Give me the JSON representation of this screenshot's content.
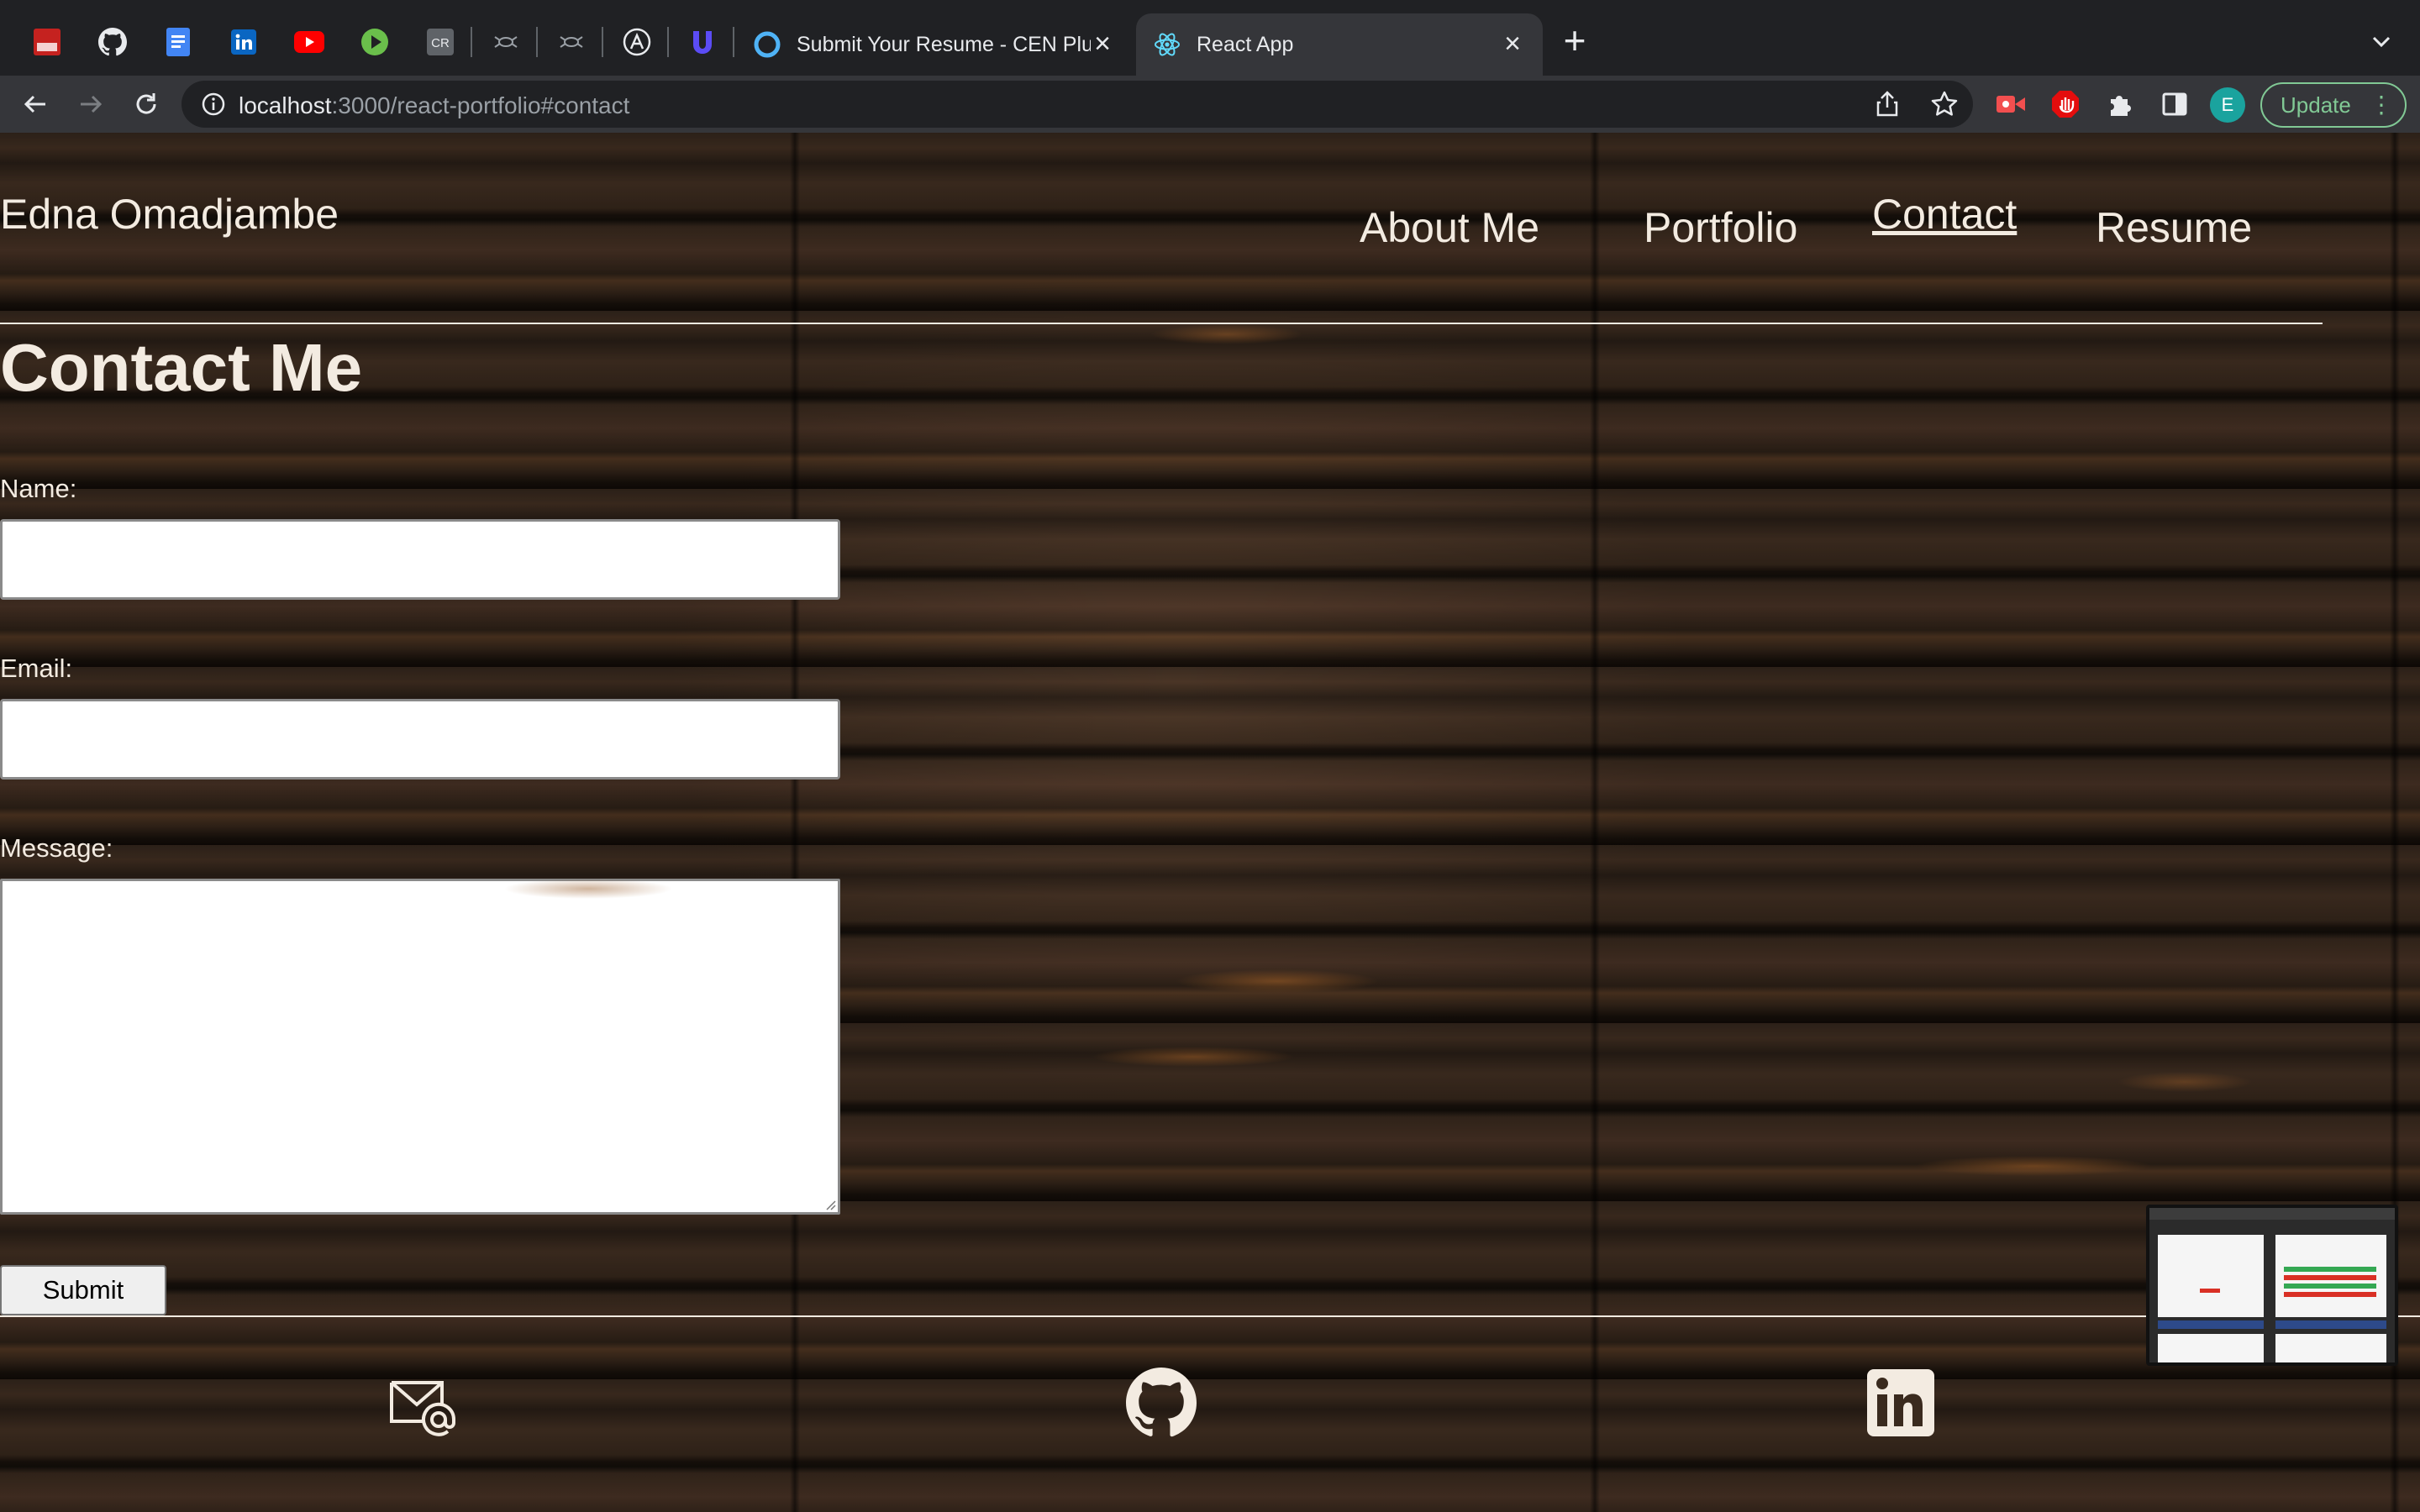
{
  "browser": {
    "pinned_tabs": [
      {
        "icon": "red-app-icon"
      },
      {
        "icon": "github-icon"
      },
      {
        "icon": "google-docs-icon"
      },
      {
        "icon": "linkedin-icon"
      },
      {
        "icon": "youtube-icon"
      },
      {
        "icon": "play-icon"
      },
      {
        "icon": "cr-icon",
        "text": "CR"
      },
      {
        "icon": "spider-icon"
      },
      {
        "icon": "spider-icon"
      },
      {
        "icon": "a-circle-icon",
        "text": "A"
      },
      {
        "icon": "u-logo-icon"
      }
    ],
    "tabs": [
      {
        "title": "Submit Your Resume - CEN Plu",
        "icon": "circle-ring-icon",
        "active": false
      },
      {
        "title": "React App",
        "icon": "react-icon",
        "active": true
      }
    ],
    "url_host": "localhost",
    "url_path": ":3000/react-portfolio#contact",
    "profile_initial": "E",
    "update_label": "Update"
  },
  "site": {
    "name": "Edna Omadjambe",
    "nav": [
      "About Me",
      "Portfolio",
      "Contact",
      "Resume"
    ],
    "current_nav": "Contact"
  },
  "contact": {
    "title": "Contact Me",
    "name_label": "Name:",
    "name_value": "",
    "email_label": "Email:",
    "email_value": "",
    "message_label": "Message:",
    "message_value": "",
    "submit_label": "Submit"
  },
  "footer": {
    "icons": [
      "email-icon",
      "github-icon",
      "linkedin-icon"
    ]
  },
  "colors": {
    "chrome_bg": "#202124",
    "toolbar_bg": "#35363a",
    "text_light": "#f3ebe1",
    "update_green": "#81c995"
  }
}
